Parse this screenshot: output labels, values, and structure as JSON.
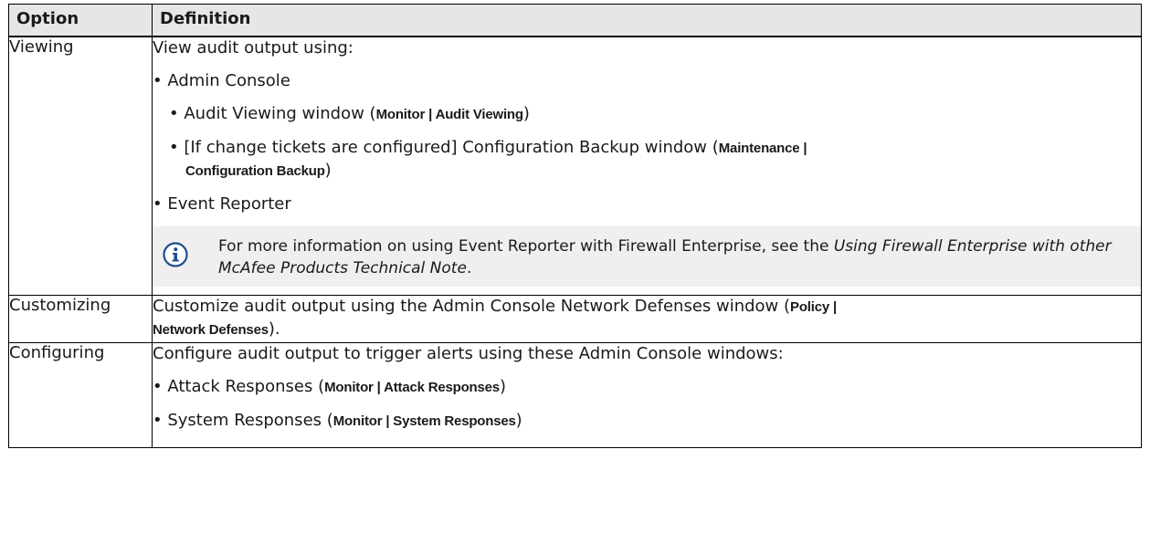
{
  "table": {
    "headers": {
      "option": "Option",
      "definition": "Definition"
    },
    "viewing": {
      "option": "Viewing",
      "intro": "View audit output using:",
      "admin_console": "Admin Console",
      "audit_viewing_text": "Audit Viewing window (",
      "audit_viewing_ui1": "Monitor",
      "audit_viewing_sep": " | ",
      "audit_viewing_ui2": "Audit Viewing",
      "audit_viewing_close": ")",
      "config_backup_text": "[If change tickets are configured] Configuration Backup window (",
      "config_backup_ui1": "Maintenance",
      "config_backup_sep": " | ",
      "config_backup_ui2": "Configuration Backup",
      "config_backup_close": ")",
      "event_reporter": "Event Reporter",
      "note_text1": "For more information on using Event Reporter with Firewall Enterprise, see the ",
      "note_italic": "Using Firewall Enterprise with other McAfee Products Technical Note",
      "note_text2": "."
    },
    "customizing": {
      "option": "Customizing",
      "text": "Customize audit output using the Admin Console Network Defenses window (",
      "ui1": "Policy",
      "sep": " | ",
      "ui2": "Network Defenses",
      "close": ")."
    },
    "configuring": {
      "option": "Configuring",
      "intro": "Configure audit output to trigger alerts using these Admin Console windows:",
      "attack_text": "Attack Responses (",
      "attack_ui1": "Monitor",
      "attack_sep": " | ",
      "attack_ui2": "Attack Responses",
      "attack_close": ")",
      "system_text": "System Responses (",
      "system_ui1": "Monitor",
      "system_sep": " | ",
      "system_ui2": "System Responses",
      "system_close": ")"
    }
  },
  "icons": {
    "note": "info-icon"
  },
  "colors": {
    "header_bg": "#e6e6e6",
    "note_bg": "#efefef",
    "icon_blue": "#1d4f91"
  }
}
